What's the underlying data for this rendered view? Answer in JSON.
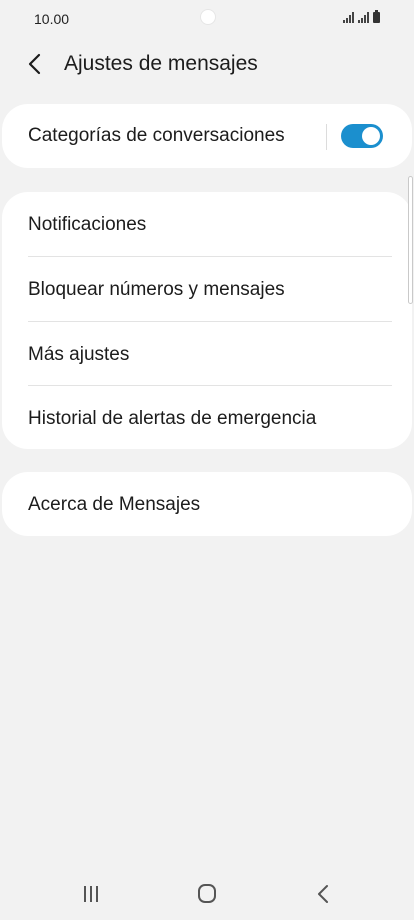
{
  "status_bar": {
    "time": "10.00",
    "icons": [
      "signal-icon",
      "signal-icon",
      "battery-icon"
    ]
  },
  "header": {
    "back_icon": "back-arrow-icon",
    "title": "Ajustes de mensajes"
  },
  "conversation_categories": {
    "label": "Categorías de conversaciones",
    "toggle_on": true,
    "accent_color": "#1b8fce"
  },
  "settings_list": {
    "items": [
      {
        "label": "Notificaciones"
      },
      {
        "label": "Bloquear números y mensajes"
      },
      {
        "label": "Más ajustes"
      },
      {
        "label": "Historial de alertas de emergencia"
      }
    ]
  },
  "about": {
    "label": "Acerca de Mensajes"
  },
  "nav_bar": {
    "icons": [
      "recents-icon",
      "home-icon",
      "back-icon"
    ]
  },
  "colors": {
    "background": "#f2f2f2",
    "card": "#ffffff",
    "text": "#1c1c1c"
  }
}
